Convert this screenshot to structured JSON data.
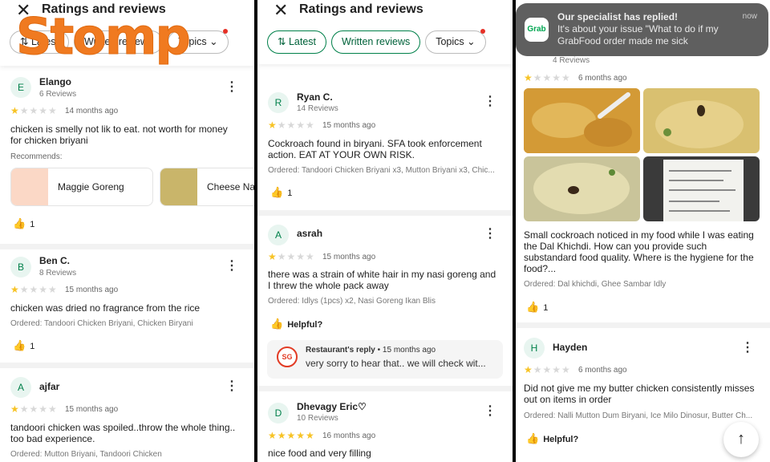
{
  "header": {
    "title": "Ratings and reviews",
    "chips": [
      "Latest",
      "Written reviews",
      "Topics"
    ]
  },
  "watermark": "Stomp",
  "panel1": {
    "reviews": [
      {
        "initial": "E",
        "name": "Elango",
        "count": "6 Reviews",
        "rating": 1,
        "time": "14 months ago",
        "text": "chicken is smelly not lik to eat. not worth for money for chicken briyani",
        "recommends_label": "Recommends:",
        "recommends": [
          "Maggie Goreng",
          "Cheese Na"
        ],
        "likes": "1"
      },
      {
        "initial": "B",
        "name": "Ben C.",
        "count": "8 Reviews",
        "rating": 1,
        "time": "15 months ago",
        "text": "chicken was dried no fragrance from the rice",
        "ordered": "Ordered: Tandoori Chicken Briyani, Chicken Biryani",
        "likes": "1"
      },
      {
        "initial": "A",
        "name": "ajfar",
        "count": "",
        "rating": 1,
        "time": "15 months ago",
        "text": "tandoori chicken was spoiled..throw the whole thing.. too bad experience.",
        "ordered": "Ordered: Mutton Briyani, Tandoori Chicken"
      }
    ]
  },
  "panel2": {
    "reviews": [
      {
        "initial": "R",
        "name": "Ryan C.",
        "count": "14 Reviews",
        "rating": 1,
        "time": "15 months ago",
        "text": "Cockroach found in biryani. SFA took enforcement action. EAT AT YOUR OWN RISK.",
        "ordered": "Ordered: Tandoori Chicken Briyani x3, Mutton Briyani x3, Chic...",
        "likes": "1"
      },
      {
        "initial": "A",
        "name": "asrah",
        "count": "",
        "rating": 1,
        "time": "15 months ago",
        "text": "there was a strain of white hair in my nasi goreng and I threw the whole pack away",
        "ordered": "Ordered: Idlys (1pcs) x2, Nasi Goreng Ikan Blis",
        "helpful": "Helpful?",
        "reply": {
          "logo": "SG",
          "label": "Restaurant's reply",
          "time": "15 months ago",
          "text": "very sorry to hear that.. we will check wit..."
        }
      },
      {
        "initial": "D",
        "name": "Dhevagy Eric♡",
        "count": "10 Reviews",
        "rating": 5,
        "time": "16 months ago",
        "text": "nice food and very filling"
      }
    ]
  },
  "panel3": {
    "notification": {
      "app": "Grab",
      "title": "Our specialist has replied!",
      "body": "It's about your issue \"What to do if my GrabFood order made me sick",
      "time": "now"
    },
    "reviews": [
      {
        "count": "4 Reviews",
        "rating": 1,
        "time": "6 months ago",
        "text": "Small cockroach noticed in my food while I was eating the Dal Khichdi. How can you provide such substandard food quality. Where is the hygiene for the food?...",
        "ordered": "Ordered: Dal khichdi, Ghee Sambar Idly",
        "likes": "1"
      },
      {
        "initial": "H",
        "name": "Hayden",
        "rating": 1,
        "time": "6 months ago",
        "text": "Did not give me my butter chicken consistently misses out on items in order",
        "ordered": "Ordered: Nalli Mutton Dum Biryani, Ice Milo Dinosur, Butter Ch...",
        "helpful": "Helpful?"
      }
    ]
  },
  "icons": {
    "close": "✕",
    "kebab": "⋮",
    "thumb": "👍",
    "chevron": "⌄",
    "arrow_up": "↑",
    "sort": "⇅"
  },
  "colors": {
    "accent_green": "#00804a",
    "star": "#f7c325",
    "notification_bg": "#5f5f5f",
    "watermark": "#f07a20"
  }
}
